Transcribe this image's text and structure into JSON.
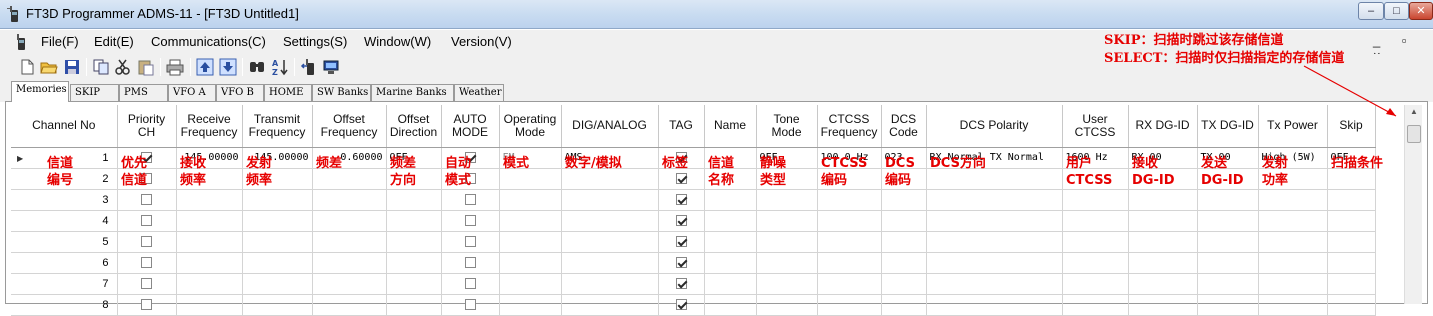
{
  "window": {
    "title": "FT3D Programmer ADMS-11 - [FT3D Untitled1]",
    "min_glyph": "‒",
    "max_glyph": "□",
    "close_glyph": "✕",
    "mdi_controls": "_ ▫ ×"
  },
  "menu": [
    "File(F)",
    "Edit(E)",
    "Communications(C)",
    "Settings(S)",
    "Window(W)",
    "Version(V)"
  ],
  "toolbar": [
    {
      "icon": "new-file-icon"
    },
    {
      "icon": "open-folder-icon"
    },
    {
      "icon": "save-icon"
    },
    {
      "icon": "copy-icon"
    },
    {
      "icon": "cut-icon"
    },
    {
      "icon": "paste-icon"
    },
    {
      "icon": "print-icon"
    },
    {
      "icon": "move-up-icon"
    },
    {
      "icon": "move-down-icon"
    },
    {
      "icon": "find-icon"
    },
    {
      "icon": "sort-az-icon"
    },
    {
      "icon": "radio-read-icon"
    },
    {
      "icon": "radio-write-icon"
    }
  ],
  "annotations": {
    "skip_note": "SKIP：扫描时跳过该存储信道",
    "select_note": "SELECT：扫描时仅扫描指定的存储信道",
    "columns": [
      "信道\n编号",
      "优先\n信道",
      "接收\n频率",
      "发射\n频率",
      "频差",
      "频差\n方向",
      "自动\n模式",
      "模式",
      "数字/模拟",
      "标签",
      "信道\n名称",
      "静噪\n类型",
      "CTCSS\n编码",
      "DCS\n编码",
      "DCS方向",
      "用户\nCTCSS",
      "接收\nDG-ID",
      "发送\nDG-ID",
      "发射\n功率",
      "扫描条件"
    ]
  },
  "tabs": [
    "Memories",
    "SKIP",
    "PMS",
    "VFO A",
    "VFO B",
    "HOME",
    "SW Banks",
    "Marine Banks",
    "Weather"
  ],
  "grid": {
    "headers": [
      "Channel No",
      "Priority\nCH",
      "Receive\nFrequency",
      "Transmit\nFrequency",
      "Offset\nFrequency",
      "Offset\nDirection",
      "AUTO\nMODE",
      "Operating\nMode",
      "DIG/ANALOG",
      "TAG",
      "Name",
      "Tone\nMode",
      "CTCSS\nFrequency",
      "DCS\nCode",
      "DCS Polarity",
      "User\nCTCSS",
      "RX DG-ID",
      "TX DG-ID",
      "Tx Power",
      "Skip"
    ],
    "rows": [
      {
        "no": "1",
        "priority": true,
        "rx": "145.00000",
        "tx": "145.00000",
        "offset": "0.60000",
        "dir": "OFF",
        "auto": true,
        "mode": "FM",
        "dig": "AMS",
        "tag": true,
        "name": "",
        "tone": "OFF",
        "ctcss": "100.0 Hz",
        "dcs": "023",
        "pol": "RX Normal TX Normal",
        "user": "1600 Hz",
        "rxdg": "RX 00",
        "txdg": "TX 00",
        "power": "High (5W)",
        "skip": "OFF"
      },
      {
        "no": "2",
        "priority": false,
        "rx": "",
        "tx": "",
        "offset": "",
        "dir": "",
        "auto": false,
        "mode": "",
        "dig": "",
        "tag": true,
        "name": "",
        "tone": "",
        "ctcss": "",
        "dcs": "",
        "pol": "",
        "user": "",
        "rxdg": "",
        "txdg": "",
        "power": "",
        "skip": ""
      },
      {
        "no": "3",
        "priority": false,
        "rx": "",
        "tx": "",
        "offset": "",
        "dir": "",
        "auto": false,
        "mode": "",
        "dig": "",
        "tag": true,
        "name": "",
        "tone": "",
        "ctcss": "",
        "dcs": "",
        "pol": "",
        "user": "",
        "rxdg": "",
        "txdg": "",
        "power": "",
        "skip": ""
      },
      {
        "no": "4",
        "priority": false,
        "rx": "",
        "tx": "",
        "offset": "",
        "dir": "",
        "auto": false,
        "mode": "",
        "dig": "",
        "tag": true,
        "name": "",
        "tone": "",
        "ctcss": "",
        "dcs": "",
        "pol": "",
        "user": "",
        "rxdg": "",
        "txdg": "",
        "power": "",
        "skip": ""
      },
      {
        "no": "5",
        "priority": false,
        "rx": "",
        "tx": "",
        "offset": "",
        "dir": "",
        "auto": false,
        "mode": "",
        "dig": "",
        "tag": true,
        "name": "",
        "tone": "",
        "ctcss": "",
        "dcs": "",
        "pol": "",
        "user": "",
        "rxdg": "",
        "txdg": "",
        "power": "",
        "skip": ""
      },
      {
        "no": "6",
        "priority": false,
        "rx": "",
        "tx": "",
        "offset": "",
        "dir": "",
        "auto": false,
        "mode": "",
        "dig": "",
        "tag": true,
        "name": "",
        "tone": "",
        "ctcss": "",
        "dcs": "",
        "pol": "",
        "user": "",
        "rxdg": "",
        "txdg": "",
        "power": "",
        "skip": ""
      },
      {
        "no": "7",
        "priority": false,
        "rx": "",
        "tx": "",
        "offset": "",
        "dir": "",
        "auto": false,
        "mode": "",
        "dig": "",
        "tag": true,
        "name": "",
        "tone": "",
        "ctcss": "",
        "dcs": "",
        "pol": "",
        "user": "",
        "rxdg": "",
        "txdg": "",
        "power": "",
        "skip": ""
      },
      {
        "no": "8",
        "priority": false,
        "rx": "",
        "tx": "",
        "offset": "",
        "dir": "",
        "auto": false,
        "mode": "",
        "dig": "",
        "tag": true,
        "name": "",
        "tone": "",
        "ctcss": "",
        "dcs": "",
        "pol": "",
        "user": "",
        "rxdg": "",
        "txdg": "",
        "power": "",
        "skip": ""
      }
    ]
  },
  "colors": {
    "annotation": "#e60000",
    "titlebar": "#c9dcf1"
  }
}
